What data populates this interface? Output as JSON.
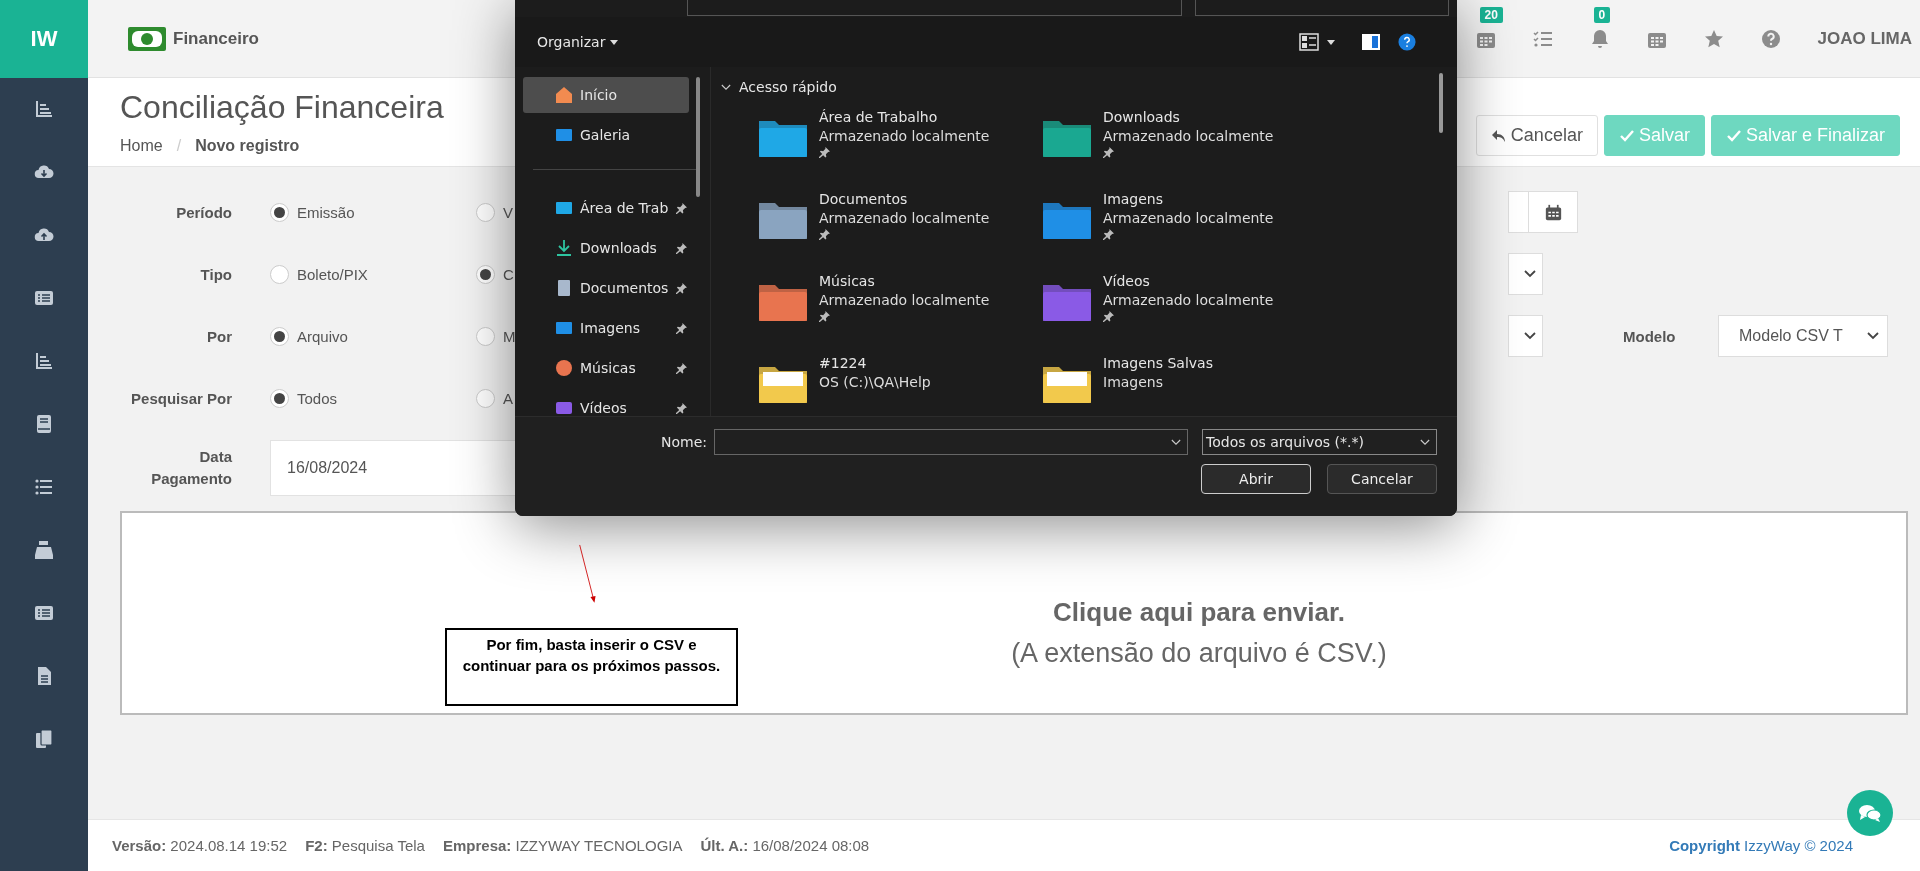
{
  "sidebar": {
    "logo": "IW"
  },
  "topbar": {
    "module": "Financeiro",
    "badges": [
      {
        "count": "20"
      },
      {
        "count": "0"
      }
    ],
    "user": "JOAO LIMA"
  },
  "page": {
    "title": "Conciliação Financeira",
    "breadcrumb": {
      "home": "Home",
      "separator": "/",
      "current": "Novo registro"
    },
    "buttons": [
      {
        "label": "Cancelar",
        "kind": "default"
      },
      {
        "label": "Salvar",
        "kind": "primary"
      },
      {
        "label": "Salvar e Finalizar",
        "kind": "primary"
      }
    ]
  },
  "form": {
    "rows": [
      {
        "label": "Período",
        "options": [
          {
            "label": "Emissão",
            "selected": true
          },
          {
            "label": "V",
            "selected": false
          }
        ]
      },
      {
        "label": "Tipo",
        "options": [
          {
            "label": "Boleto/PIX",
            "selected": false
          },
          {
            "label": "C",
            "selected": true
          }
        ]
      },
      {
        "label": "Por",
        "options": [
          {
            "label": "Arquivo",
            "selected": true
          },
          {
            "label": "M",
            "selected": false
          }
        ]
      },
      {
        "label": "Pesquisar Por",
        "options": [
          {
            "label": "Todos",
            "selected": true
          },
          {
            "label": "A",
            "selected": false
          }
        ]
      }
    ],
    "data_pagamento": {
      "label": "Data Pagamento",
      "value": "16/08/2024"
    },
    "modelo": {
      "label": "Modelo",
      "value": "Modelo CSV T"
    }
  },
  "upload": {
    "title": "Clique aqui para enviar.",
    "subtitle": "(A extensão do arquivo é CSV.)"
  },
  "annotation": {
    "text": "Por fim, basta inserir o CSV e continuar para os próximos passos."
  },
  "dialog": {
    "organize": "Organizar",
    "nav": [
      {
        "label": "Início",
        "kind": "home",
        "selected": true,
        "pinned": false
      },
      {
        "label": "Galeria",
        "kind": "gallery",
        "selected": false,
        "pinned": false
      },
      {
        "label": "Área de Trab",
        "kind": "desktop",
        "selected": false,
        "pinned": true
      },
      {
        "label": "Downloads",
        "kind": "downloads",
        "selected": false,
        "pinned": true
      },
      {
        "label": "Documentos",
        "kind": "documents",
        "selected": false,
        "pinned": true
      },
      {
        "label": "Imagens",
        "kind": "pictures",
        "selected": false,
        "pinned": true
      },
      {
        "label": "Músicas",
        "kind": "music",
        "selected": false,
        "pinned": true
      },
      {
        "label": "Vídeos",
        "kind": "videos",
        "selected": false,
        "pinned": true
      }
    ],
    "section": "Acesso rápido",
    "tiles": [
      {
        "title": "Área de Trabalho",
        "subtitle": "Armazenado localmente",
        "kind": "desktop",
        "pinned": true
      },
      {
        "title": "Downloads",
        "subtitle": "Armazenado localmente",
        "kind": "downloads",
        "pinned": true
      },
      {
        "title": "Documentos",
        "subtitle": "Armazenado localmente",
        "kind": "documents",
        "pinned": true
      },
      {
        "title": "Imagens",
        "subtitle": "Armazenado localmente",
        "kind": "pictures",
        "pinned": true
      },
      {
        "title": "Músicas",
        "subtitle": "Armazenado localmente",
        "kind": "music",
        "pinned": true
      },
      {
        "title": "Vídeos",
        "subtitle": "Armazenado localmente",
        "kind": "videos",
        "pinned": true
      },
      {
        "title": "#1224",
        "subtitle": "OS (C:)\\QA\\Help",
        "kind": "folder",
        "pinned": false
      },
      {
        "title": "Imagens Salvas",
        "subtitle": "Imagens",
        "kind": "folder",
        "pinned": false
      }
    ],
    "name_label": "Nome:",
    "filter": "Todos os arquivos (*.*)",
    "buttons": [
      "Abrir",
      "Cancelar"
    ]
  },
  "footer": {
    "items": [
      {
        "key": "Versão:",
        "value": "2024.08.14 19:52"
      },
      {
        "key": "F2:",
        "value": "Pesquisa Tela"
      },
      {
        "key": "Empresa:",
        "value": "IZZYWAY TECNOLOGIA"
      },
      {
        "key": "Últ. A.:",
        "value": "16/08/2024 08:08"
      }
    ],
    "copyright": {
      "key": "Copyright",
      "value": "IzzyWay © 2024"
    }
  }
}
